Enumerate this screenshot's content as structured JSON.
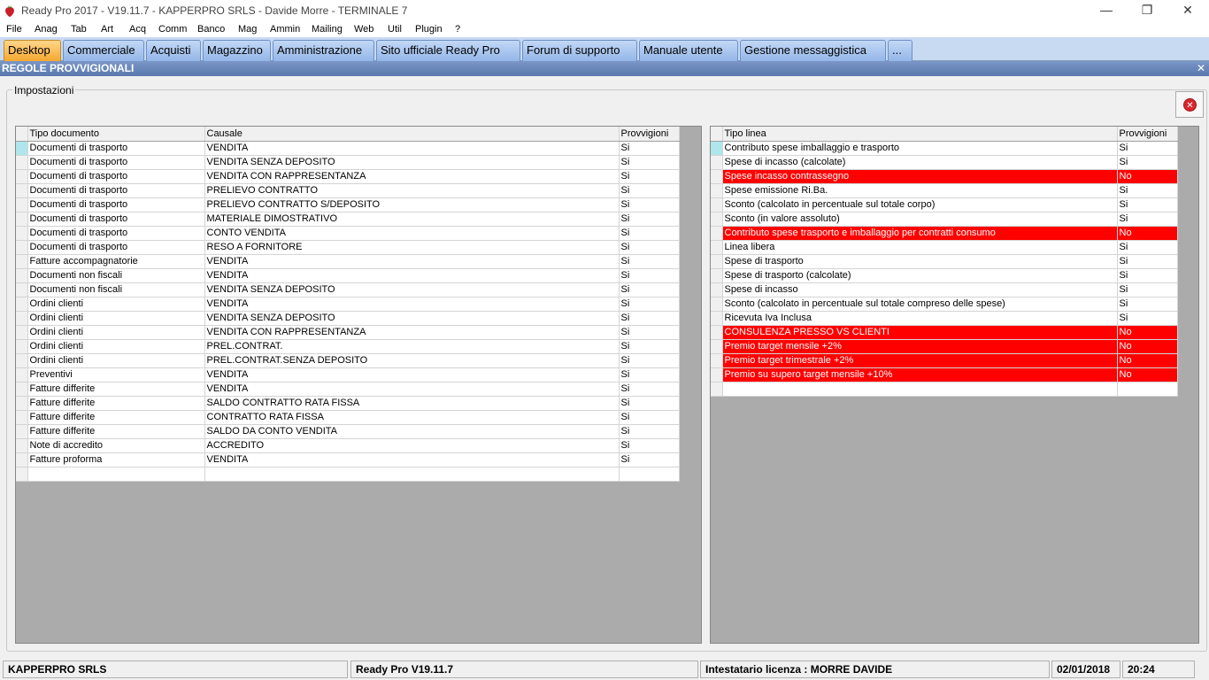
{
  "window": {
    "title": "Ready Pro 2017 - V19.11.7 - KAPPERPRO SRLS - Davide Morre - TERMINALE 7",
    "minimize": "—",
    "restore": "❐",
    "close": "✕"
  },
  "menu": [
    "File",
    "Anag",
    "Tab",
    "Art",
    "Acq",
    "Comm",
    "Banco",
    "Mag",
    "Ammin",
    "Mailing",
    "Web",
    "Util",
    "Plugin",
    "?"
  ],
  "tabs": [
    "Desktop",
    "Commerciale",
    "Acquisti",
    "Magazzino",
    "Amministrazione",
    "Sito ufficiale Ready Pro",
    "Forum di supporto",
    "Manuale utente",
    "Gestione messaggistica",
    "..."
  ],
  "panel": {
    "title": "REGOLE PROVVIGIONALI",
    "close": "✕"
  },
  "group": {
    "legend": "Impostazioni"
  },
  "left_grid": {
    "headers": [
      "Tipo documento",
      "Causale",
      "Provvigioni"
    ],
    "rows": [
      [
        "Documenti di trasporto",
        "VENDITA",
        "Si"
      ],
      [
        "Documenti di trasporto",
        "VENDITA SENZA DEPOSITO",
        "Si"
      ],
      [
        "Documenti di trasporto",
        "VENDITA CON RAPPRESENTANZA",
        "Si"
      ],
      [
        "Documenti di trasporto",
        "PRELIEVO CONTRATTO",
        "Si"
      ],
      [
        "Documenti di trasporto",
        "PRELIEVO CONTRATTO S/DEPOSITO",
        "Si"
      ],
      [
        "Documenti di trasporto",
        "MATERIALE DIMOSTRATIVO",
        "Si"
      ],
      [
        "Documenti di trasporto",
        "CONTO VENDITA",
        "Si"
      ],
      [
        "Documenti di trasporto",
        "RESO A FORNITORE",
        "Si"
      ],
      [
        "Fatture accompagnatorie",
        "VENDITA",
        "Si"
      ],
      [
        "Documenti non fiscali",
        "VENDITA",
        "Si"
      ],
      [
        "Documenti non fiscali",
        "VENDITA SENZA DEPOSITO",
        "Si"
      ],
      [
        "Ordini clienti",
        "VENDITA",
        "Si"
      ],
      [
        "Ordini clienti",
        "VENDITA SENZA DEPOSITO",
        "Si"
      ],
      [
        "Ordini clienti",
        "VENDITA CON RAPPRESENTANZA",
        "Si"
      ],
      [
        "Ordini clienti",
        "PREL.CONTRAT.",
        "Si"
      ],
      [
        "Ordini clienti",
        "PREL.CONTRAT.SENZA DEPOSITO",
        "Si"
      ],
      [
        "Preventivi",
        "VENDITA",
        "Si"
      ],
      [
        "Fatture differite",
        "VENDITA",
        "Si"
      ],
      [
        "Fatture differite",
        "SALDO CONTRATTO RATA FISSA",
        "Si"
      ],
      [
        "Fatture differite",
        "CONTRATTO RATA FISSA",
        "Si"
      ],
      [
        "Fatture differite",
        "SALDO DA CONTO VENDITA",
        "Si"
      ],
      [
        "Note di accredito",
        "ACCREDITO",
        "Si"
      ],
      [
        "Fatture proforma",
        "VENDITA",
        "Si"
      ],
      [
        "",
        "",
        ""
      ]
    ]
  },
  "right_grid": {
    "headers": [
      "Tipo linea",
      "Provvigioni"
    ],
    "rows": [
      [
        "Contributo spese imballaggio e trasporto",
        "Si"
      ],
      [
        "Spese di incasso (calcolate)",
        "Si"
      ],
      [
        "Spese incasso contrassegno",
        "No"
      ],
      [
        "Spese emissione Ri.Ba.",
        "Si"
      ],
      [
        "Sconto (calcolato in percentuale sul totale corpo)",
        "Si"
      ],
      [
        "Sconto (in valore assoluto)",
        "Si"
      ],
      [
        "Contributo spese trasporto e imballaggio per contratti consumo",
        "No"
      ],
      [
        "Linea libera",
        "Si"
      ],
      [
        "Spese di trasporto",
        "Si"
      ],
      [
        "Spese di trasporto (calcolate)",
        "Si"
      ],
      [
        "Spese di incasso",
        "Si"
      ],
      [
        "Sconto (calcolato in percentuale sul totale compreso delle spese)",
        "Si"
      ],
      [
        "Ricevuta Iva Inclusa",
        "Si"
      ],
      [
        "CONSULENZA PRESSO VS CLIENTI",
        "No"
      ],
      [
        "Premio target mensile +2%",
        "No"
      ],
      [
        "Premio target trimestrale +2%",
        "No"
      ],
      [
        "Premio su supero target mensile +10%",
        "No"
      ],
      [
        "",
        ""
      ]
    ]
  },
  "status": {
    "company": "KAPPERPRO SRLS",
    "version": "Ready Pro V19.11.7",
    "license": "Intestatario licenza : MORRE DAVIDE",
    "date": "02/01/2018",
    "time": "20:24"
  },
  "colors": {
    "highlight_no": "#ff0000",
    "selected_indicator": "#aee6ec",
    "active_tab": "#f4a830"
  }
}
